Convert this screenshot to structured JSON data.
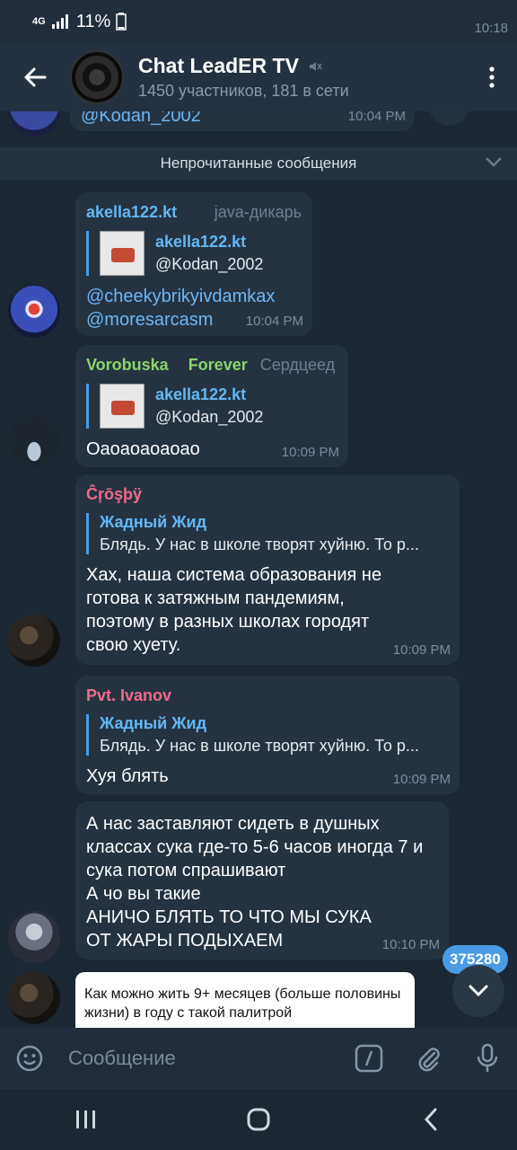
{
  "status_bar": {
    "time": "10:18",
    "network": "4G",
    "battery": "11%"
  },
  "header": {
    "title": "Chat LeadER TV",
    "subtitle": "1450 участников, 181 в сети",
    "muted_icon": "muted-speaker-icon"
  },
  "partial_message": {
    "text": "@Kodan_2002",
    "time": "10:04 PM"
  },
  "unread_divider": "Непрочитанные сообщения",
  "messages": [
    {
      "sender": "akella122.kt",
      "badge": "java-дикарь",
      "reply_name": "akella122.kt",
      "reply_text": "@Kodan_2002",
      "line1": "@cheekybrikyivdamkax",
      "line2": "@moresarcasm",
      "time": "10:04 PM"
    },
    {
      "sender_first": "Vorobuska",
      "sender_last": "Forever",
      "badge": "Сердцеед",
      "reply_name": "akella122.kt",
      "reply_text": "@Kodan_2002",
      "text": "Оаоаоаоаоао",
      "time": "10:09 PM"
    },
    {
      "sender": "Ĉŗōşþÿ",
      "reply_name": "Жадный Жид",
      "reply_text": "Блядь. У нас в школе творят хуйню. То р...",
      "text": "Хах, наша система образования не готова к затяжным пандемиям, поэтому в разных школах городят свою хуету.",
      "time": "10:09 PM"
    },
    {
      "sender": "Pvt. Ivanov",
      "reply_name": "Жадный Жид",
      "reply_text": "Блядь. У нас в школе творят хуйню. То р...",
      "text": "Хуя блять",
      "time": "10:09 PM"
    },
    {
      "line1": "А нас заставляют сидеть в душных классах сука где-то 5-6 часов иногда 7 и сука потом спрашивают",
      "line2": "А чо вы такие",
      "line3": "АНИЧО БЛЯТЬ ТО ЧТО МЫ СУКА ОТ ЖАРЫ ПОДЫХАЕМ",
      "time": "10:10 PM"
    },
    {
      "text": "Как можно жить 9+ месяцев (больше половины жизни) в году с такой палитрой"
    }
  ],
  "unread_count": "375280",
  "input": {
    "placeholder": "Сообщение"
  },
  "colors": {
    "accent": "#4a9be4",
    "name_blue": "#63b7f5",
    "name_green": "#8bd46b",
    "name_pink": "#ee6b88",
    "badge_gray": "#6d7f91"
  }
}
